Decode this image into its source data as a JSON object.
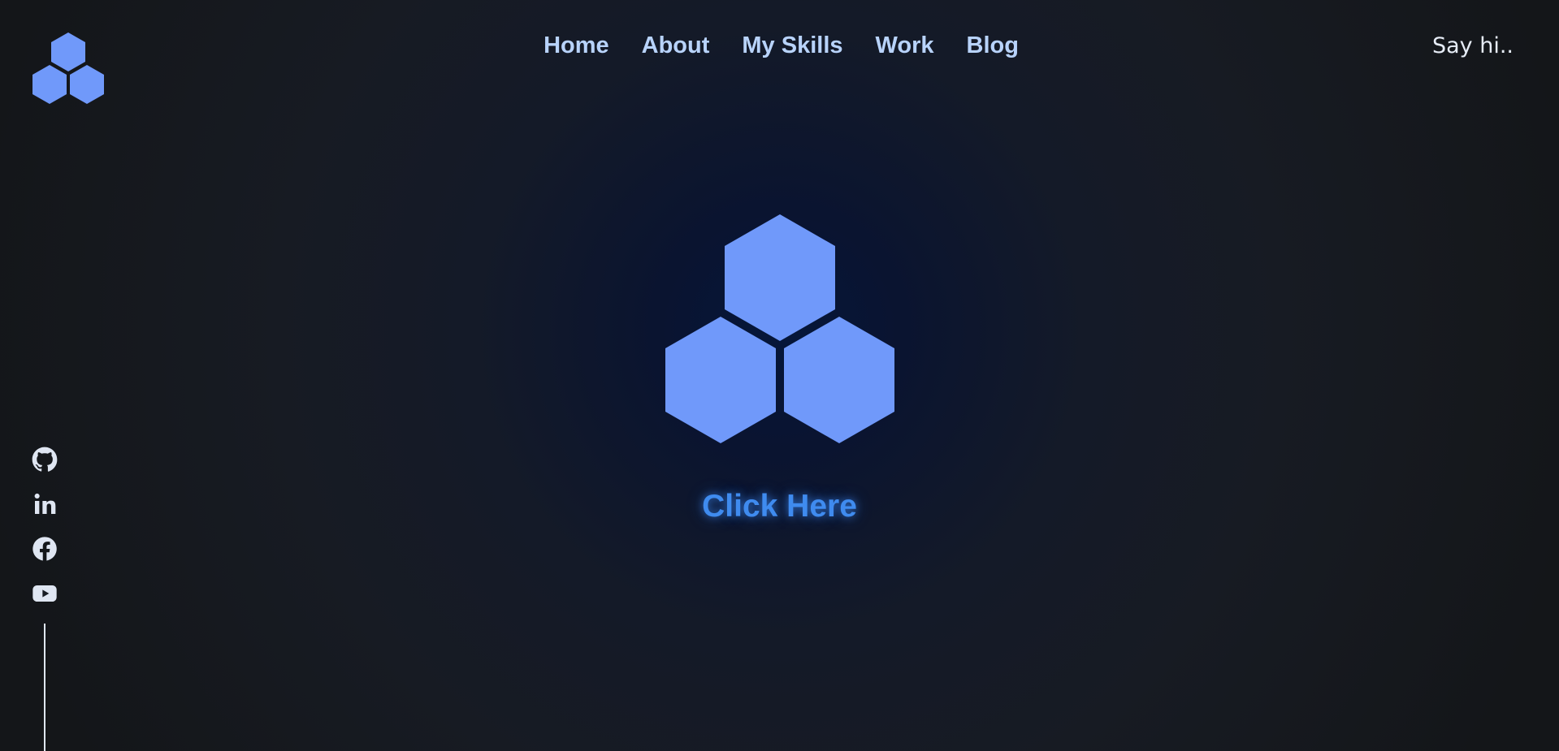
{
  "brand": {
    "logo_icon": "hexagon-cluster-icon",
    "accent_color": "#7099fa"
  },
  "nav": {
    "items": [
      {
        "label": "Home"
      },
      {
        "label": "About"
      },
      {
        "label": "My Skills"
      },
      {
        "label": "Work"
      },
      {
        "label": "Blog"
      }
    ],
    "cta_label": "Say hi.."
  },
  "socials": [
    {
      "name": "github-icon"
    },
    {
      "name": "linkedin-icon"
    },
    {
      "name": "facebook-icon"
    },
    {
      "name": "youtube-icon"
    }
  ],
  "hero": {
    "icon": "hexagon-cluster-icon",
    "cta_label": "Click Here",
    "cta_color": "#3f8bef"
  }
}
